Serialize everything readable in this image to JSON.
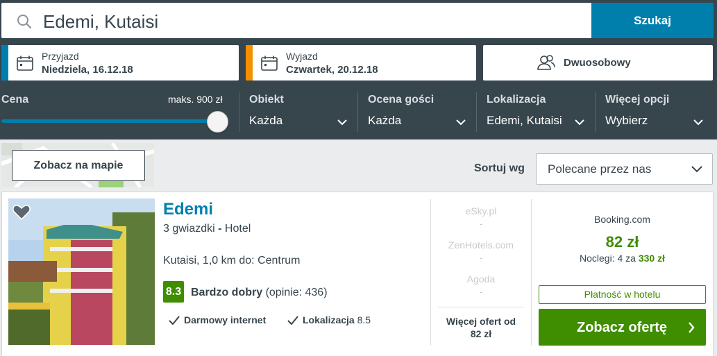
{
  "search": {
    "value": "Edemi, Kutaisi",
    "button": "Szukaj"
  },
  "checkin": {
    "label": "Przyjazd",
    "date": "Niedziela, 16.12.18",
    "accent": "#007fad"
  },
  "checkout": {
    "label": "Wyjazd",
    "date": "Czwartek, 20.12.18",
    "accent": "#f48f00"
  },
  "room": {
    "label": "Dwuosobowy"
  },
  "filters": {
    "price": {
      "label": "Cena",
      "max": "maks. 900 zł"
    },
    "property": {
      "label": "Obiekt",
      "value": "Każda"
    },
    "rating": {
      "label": "Ocena gości",
      "value": "Każda"
    },
    "location": {
      "label": "Lokalizacja",
      "value": "Edemi, Kutaisi"
    },
    "more": {
      "label": "Więcej opcji",
      "value": "Wybierz"
    }
  },
  "map": {
    "button": "Zobacz na mapie"
  },
  "sort": {
    "label": "Sortuj wg",
    "value": "Polecane przez nas"
  },
  "hotel": {
    "name": "Edemi",
    "stars": "3 gwiazdki",
    "sep": " - ",
    "type": "Hotel",
    "location": "Kutaisi, 1,0 km do: Centrum",
    "rating_score": "8.3",
    "rating_text": "Bardzo dobry",
    "rating_reviews": "(opinie: 436)",
    "features": [
      {
        "name": "Darmowy internet",
        "score": ""
      },
      {
        "name": "Lokalizacja",
        "score": "8.5"
      }
    ]
  },
  "other_offers": [
    {
      "site": "eSky.pl",
      "price": "-"
    },
    {
      "site": "ZenHotels.com",
      "price": "-"
    },
    {
      "site": "Agoda",
      "price": "-"
    }
  ],
  "more_offers": {
    "line1": "Więcej ofert od",
    "line2": "82 zł"
  },
  "deal": {
    "site": "Booking.com",
    "price": "82 zł",
    "nights_prefix": "Noclegi: 4 za",
    "nights_total": "330 zł",
    "pay_label": "Płatność w hotelu",
    "button": "Zobacz ofertę"
  },
  "colors": {
    "primary": "#007fad",
    "green": "#3f8d00",
    "dark": "#37454d"
  }
}
